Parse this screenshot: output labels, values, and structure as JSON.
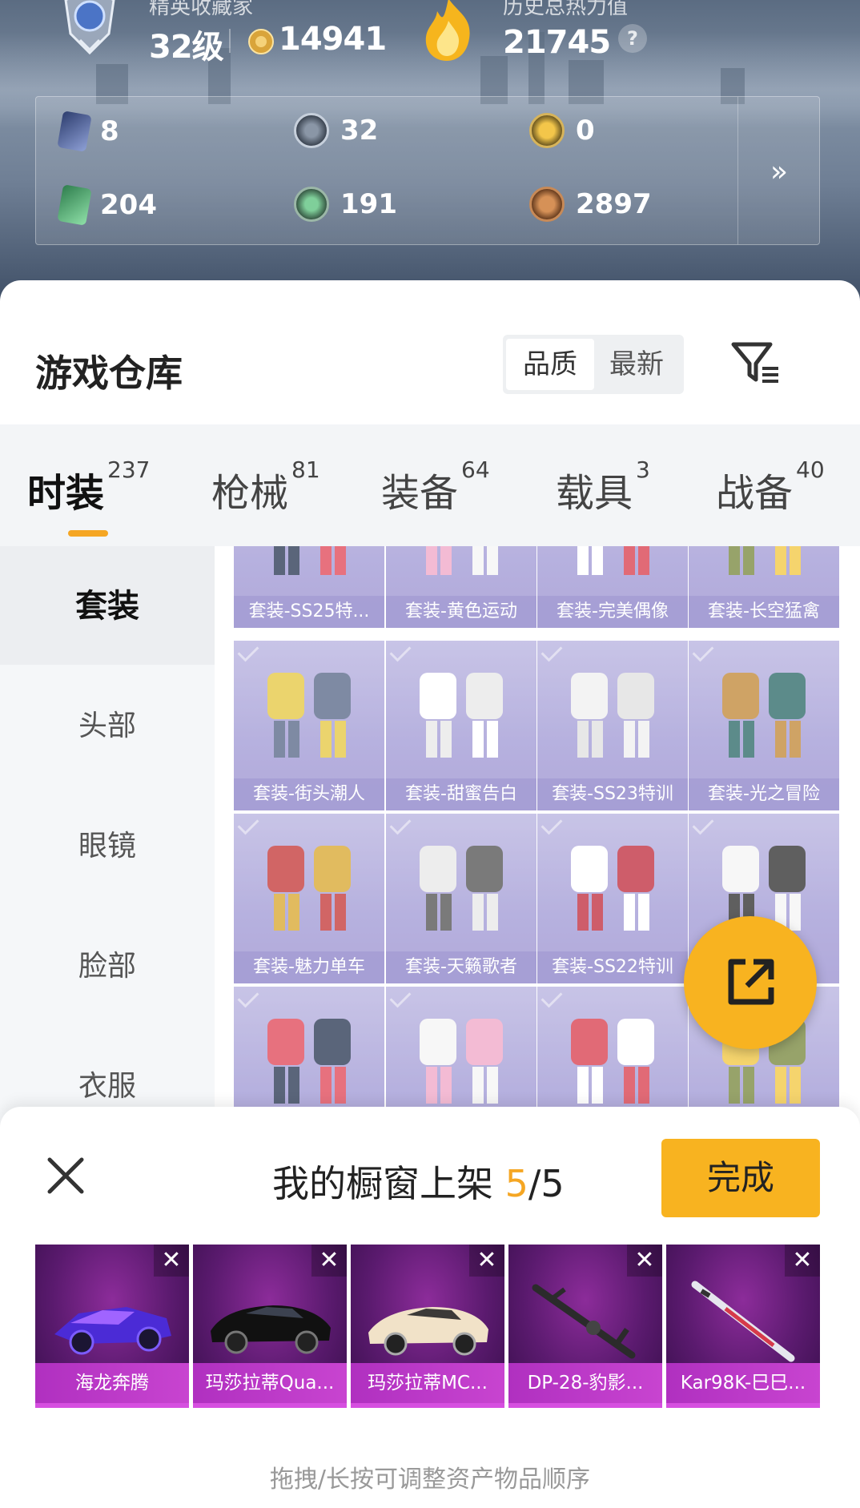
{
  "header": {
    "rank_subtitle": "精英收藏家",
    "level": "32级",
    "coin_value": "14941",
    "heat_subtitle": "历史总热力值",
    "heat_value": "21745",
    "help_icon": "?",
    "stats": [
      {
        "icon": "card-icon",
        "value": "8"
      },
      {
        "icon": "gear-coin-icon",
        "value": "32"
      },
      {
        "icon": "gold-badge-icon",
        "value": "0"
      },
      {
        "icon": "ticket-icon",
        "value": "204"
      },
      {
        "icon": "green-orb-icon",
        "value": "191"
      },
      {
        "icon": "bronze-coin-icon",
        "value": "2897"
      }
    ],
    "more_label": "»"
  },
  "warehouse": {
    "title": "游戏仓库",
    "sort_options": [
      "品质",
      "最新"
    ],
    "filter_icon": "filter-icon"
  },
  "tabs": [
    {
      "label": "时装",
      "count": "237",
      "active": true
    },
    {
      "label": "枪械",
      "count": "81"
    },
    {
      "label": "装备",
      "count": "64"
    },
    {
      "label": "载具",
      "count": "3"
    },
    {
      "label": "战备",
      "count": "40"
    }
  ],
  "side_categories": [
    "套装",
    "头部",
    "眼镜",
    "脸部",
    "衣服"
  ],
  "items": [
    "套装-SS25特...",
    "套装-黄色运动",
    "套装-完美偶像",
    "套装-长空猛禽",
    "套装-街头潮人",
    "套装-甜蜜告白",
    "套装-SS23特训",
    "套装-光之冒险",
    "套装-魅力单车",
    "套装-天籁歌者",
    "套装-SS22特训",
    "",
    "",
    "",
    "",
    ""
  ],
  "share_icon": "share-icon",
  "showcase": {
    "title_prefix": "我的橱窗上架 ",
    "count": "5",
    "total": "/5",
    "done_label": "完成",
    "slots": [
      "海龙奔腾",
      "玛莎拉蒂Qua...",
      "玛莎拉蒂MC...",
      "DP-28-豹影...",
      "Kar98K-巳巳..."
    ],
    "remove_label": "✕",
    "hint": "拖拽/长按可调整资产物品顺序"
  },
  "colors": {
    "accent": "#f8b320",
    "item_purple": "#a29bd6",
    "slot_magenta": "#c844d0"
  }
}
